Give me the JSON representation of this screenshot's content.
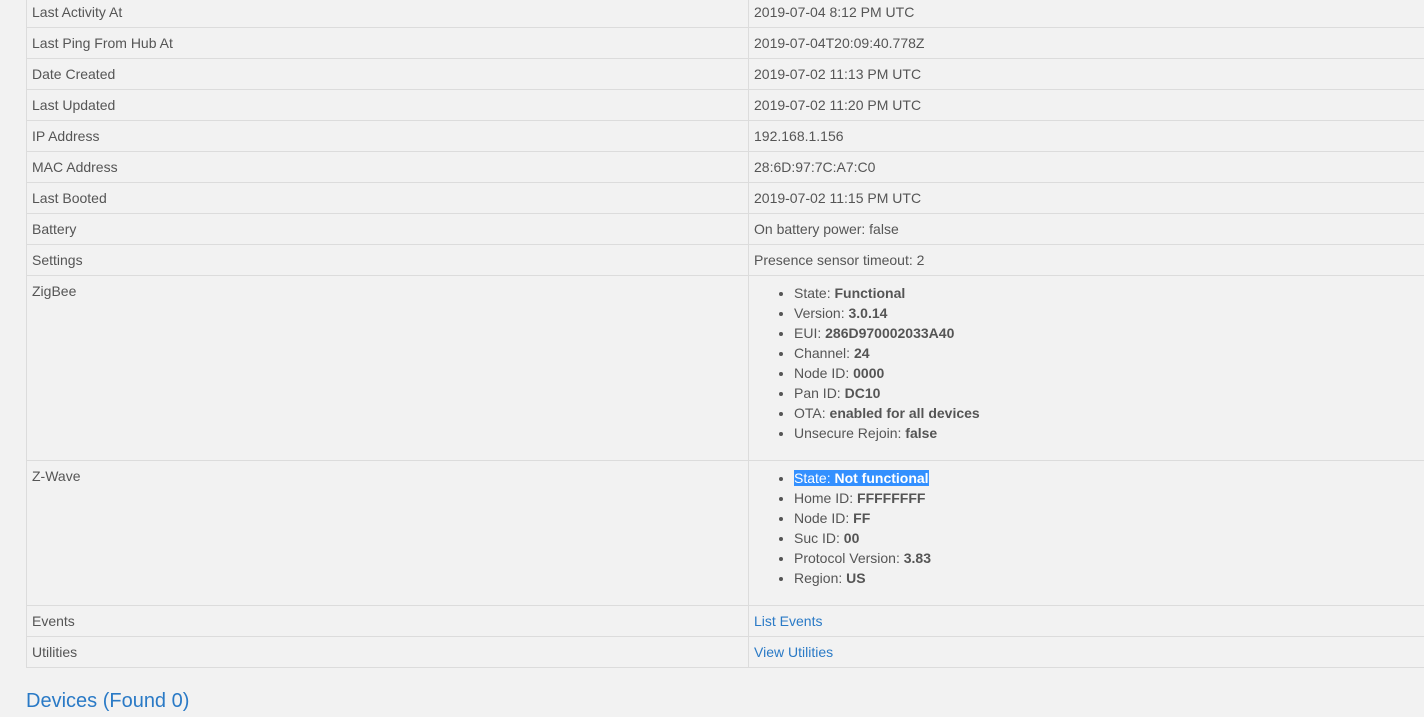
{
  "rows": [
    {
      "label": "Last Activity At",
      "value": "2019-07-04 8:12 PM UTC"
    },
    {
      "label": "Last Ping From Hub At",
      "value": "2019-07-04T20:09:40.778Z"
    },
    {
      "label": "Date Created",
      "value": "2019-07-02 11:13 PM UTC"
    },
    {
      "label": "Last Updated",
      "value": "2019-07-02 11:20 PM UTC"
    },
    {
      "label": "IP Address",
      "value": "192.168.1.156"
    },
    {
      "label": "MAC Address",
      "value": "28:6D:97:7C:A7:C0"
    },
    {
      "label": "Last Booted",
      "value": "2019-07-02 11:15 PM UTC"
    },
    {
      "label": "Battery",
      "value": "On battery power: false"
    },
    {
      "label": "Settings",
      "value": "Presence sensor timeout: 2"
    }
  ],
  "zigbee": {
    "label": "ZigBee",
    "items": [
      {
        "key": "State: ",
        "value": "Functional"
      },
      {
        "key": "Version: ",
        "value": "3.0.14"
      },
      {
        "key": "EUI: ",
        "value": "286D970002033A40"
      },
      {
        "key": "Channel: ",
        "value": "24"
      },
      {
        "key": "Node ID: ",
        "value": "0000"
      },
      {
        "key": "Pan ID: ",
        "value": "DC10"
      },
      {
        "key": "OTA: ",
        "value": "enabled for all devices"
      },
      {
        "key": "Unsecure Rejoin: ",
        "value": "false"
      }
    ]
  },
  "zwave": {
    "label": "Z-Wave",
    "items": [
      {
        "key": "State: ",
        "value": "Not functional"
      },
      {
        "key": "Home ID: ",
        "value": "FFFFFFFF"
      },
      {
        "key": "Node ID: ",
        "value": "FF"
      },
      {
        "key": "Suc ID: ",
        "value": "00"
      },
      {
        "key": "Protocol Version: ",
        "value": "3.83"
      },
      {
        "key": "Region: ",
        "value": "US"
      }
    ]
  },
  "events": {
    "label": "Events",
    "link": "List Events"
  },
  "utilities": {
    "label": "Utilities",
    "link": "View Utilities"
  },
  "devices_heading": "Devices (Found 0)",
  "colors": {
    "background": "#f2f2f2",
    "text": "#555555",
    "link": "#2a7ac6",
    "selection": "#3390ff",
    "border": "#dcdcdc"
  }
}
